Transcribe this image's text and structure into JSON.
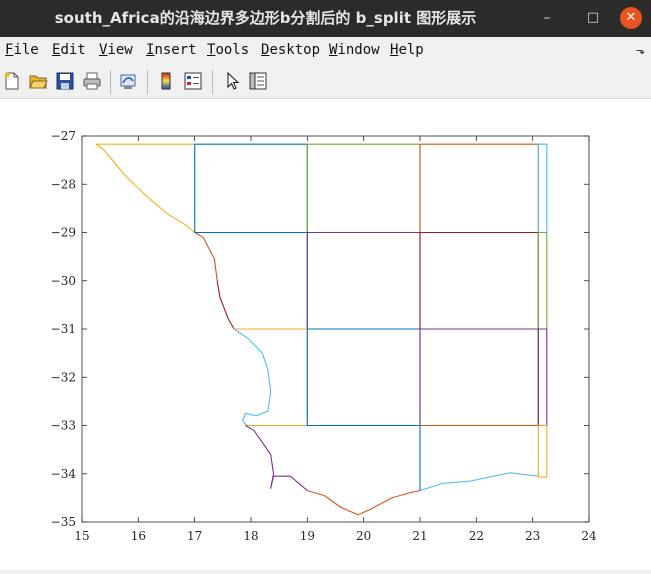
{
  "window": {
    "title": "south_Africa的沿海边界多边形b分割后的 b_split 图形展示",
    "minimize_glyph": "–",
    "maximize_glyph": "□",
    "close_glyph": "✕"
  },
  "menu": [
    {
      "key": "F",
      "rest": "ile"
    },
    {
      "key": "E",
      "rest": "dit"
    },
    {
      "key": "V",
      "rest": "iew"
    },
    {
      "key": "I",
      "rest": "nsert"
    },
    {
      "key": "T",
      "rest": "ools"
    },
    {
      "key": "D",
      "rest": "esktop"
    },
    {
      "key": "W",
      "rest": "indow"
    },
    {
      "key": "H",
      "rest": "elp"
    }
  ],
  "menu_overflow_glyph": "⬎",
  "toolbar": [
    "new-figure-icon",
    "open-file-icon",
    "save-icon",
    "print-icon",
    "link-plot-icon",
    "insert-colorbar-icon",
    "insert-legend-icon",
    "edit-plot-arrow-icon",
    "property-editor-icon"
  ],
  "chart_data": {
    "type": "line",
    "title": "",
    "xlabel": "",
    "ylabel": "",
    "xlim": [
      15,
      24
    ],
    "ylim": [
      -35,
      -27
    ],
    "xticks": [
      15,
      16,
      17,
      18,
      19,
      20,
      21,
      22,
      23,
      24
    ],
    "yticks": [
      -27,
      -28,
      -29,
      -30,
      -31,
      -32,
      -33,
      -34,
      -35
    ],
    "grid": false,
    "legend": "none",
    "series": [
      {
        "color": "#EDB120",
        "points": [
          [
            17,
            -27.17
          ],
          [
            15.25,
            -27.17
          ],
          [
            15.4,
            -27.3
          ],
          [
            15.75,
            -27.8
          ],
          [
            16.1,
            -28.2
          ],
          [
            16.5,
            -28.6
          ],
          [
            16.85,
            -28.85
          ],
          [
            17,
            -29
          ]
        ]
      },
      {
        "color": "#0072BD",
        "points": [
          [
            17,
            -29
          ],
          [
            17,
            -27.17
          ],
          [
            19,
            -27.17
          ],
          [
            19,
            -29
          ],
          [
            17,
            -29
          ]
        ]
      },
      {
        "color": "#77AC30",
        "points": [
          [
            19,
            -27.17
          ],
          [
            21,
            -27.17
          ],
          [
            21,
            -29
          ],
          [
            19,
            -29
          ],
          [
            19,
            -27.17
          ]
        ]
      },
      {
        "color": "#D95319",
        "points": [
          [
            21,
            -27.17
          ],
          [
            23.1,
            -27.17
          ],
          [
            23.1,
            -29
          ],
          [
            21,
            -29
          ],
          [
            21,
            -27.17
          ]
        ]
      },
      {
        "color": "#4DBEEE",
        "points": [
          [
            23.1,
            -27.17
          ],
          [
            23.25,
            -27.17
          ],
          [
            23.25,
            -29
          ],
          [
            23.1,
            -29
          ],
          [
            23.1,
            -27.17
          ]
        ]
      },
      {
        "color": "#D95319",
        "points": [
          [
            17,
            -29
          ],
          [
            17.15,
            -29.1
          ],
          [
            17.35,
            -29.55
          ],
          [
            17.4,
            -30
          ]
        ]
      },
      {
        "color": "#A2142F",
        "points": [
          [
            17.4,
            -30
          ],
          [
            17.45,
            -30.35
          ],
          [
            17.6,
            -30.8
          ],
          [
            17.7,
            -31
          ]
        ]
      },
      {
        "color": "#0072BD",
        "points": [
          [
            17,
            -29
          ],
          [
            19,
            -29
          ],
          [
            19,
            -31
          ],
          [
            17.7,
            -31
          ]
        ]
      },
      {
        "color": "#7E2F8E",
        "points": [
          [
            19,
            -29
          ],
          [
            21,
            -29
          ],
          [
            21,
            -31
          ],
          [
            19,
            -31
          ],
          [
            19,
            -29
          ]
        ]
      },
      {
        "color": "#A2142F",
        "points": [
          [
            21,
            -29
          ],
          [
            23.1,
            -29
          ],
          [
            23.1,
            -31
          ],
          [
            21,
            -31
          ],
          [
            21,
            -29
          ]
        ]
      },
      {
        "color": "#77AC30",
        "points": [
          [
            23.1,
            -29
          ],
          [
            23.25,
            -29
          ],
          [
            23.25,
            -31
          ],
          [
            23.1,
            -31
          ],
          [
            23.1,
            -29
          ]
        ]
      },
      {
        "color": "#4DBEEE",
        "points": [
          [
            17.7,
            -31
          ],
          [
            17.95,
            -31.2
          ],
          [
            18.2,
            -31.5
          ],
          [
            18.3,
            -31.85
          ],
          [
            18.35,
            -32.3
          ],
          [
            18.3,
            -32.7
          ],
          [
            18.1,
            -32.8
          ],
          [
            17.9,
            -32.75
          ],
          [
            17.85,
            -32.9
          ],
          [
            17.92,
            -33
          ]
        ]
      },
      {
        "color": "#EDB120",
        "points": [
          [
            17.7,
            -31
          ],
          [
            19,
            -31
          ],
          [
            19,
            -33
          ],
          [
            17.9,
            -33
          ]
        ]
      },
      {
        "color": "#0072BD",
        "points": [
          [
            19,
            -31
          ],
          [
            21,
            -31
          ],
          [
            21,
            -33
          ],
          [
            19,
            -33
          ],
          [
            19,
            -31
          ]
        ]
      },
      {
        "color": "#7E2F8E",
        "points": [
          [
            21,
            -31
          ],
          [
            23.1,
            -31
          ],
          [
            23.1,
            -33
          ],
          [
            21,
            -33
          ],
          [
            21,
            -31
          ]
        ]
      },
      {
        "color": "#7E2F8E",
        "points": [
          [
            23.1,
            -31
          ],
          [
            23.25,
            -31
          ],
          [
            23.25,
            -33
          ],
          [
            23.1,
            -33
          ],
          [
            23.1,
            -31
          ]
        ]
      },
      {
        "color": "#7E2F8E",
        "points": [
          [
            17.9,
            -33
          ],
          [
            18.05,
            -33.1
          ],
          [
            18.2,
            -33.35
          ],
          [
            18.35,
            -33.6
          ],
          [
            18.4,
            -34
          ],
          [
            18.35,
            -34.3
          ],
          [
            18.4,
            -34.05
          ],
          [
            18.7,
            -34.05
          ],
          [
            19,
            -34.35
          ]
        ]
      },
      {
        "color": "#D95319",
        "points": [
          [
            19,
            -34.35
          ],
          [
            19.3,
            -34.45
          ],
          [
            19.6,
            -34.7
          ],
          [
            19.9,
            -34.85
          ],
          [
            20.1,
            -34.75
          ],
          [
            20.5,
            -34.5
          ],
          [
            20.8,
            -34.4
          ],
          [
            21,
            -34.35
          ]
        ]
      },
      {
        "color": "#0072BD",
        "points": [
          [
            19,
            -33
          ],
          [
            21,
            -33
          ],
          [
            21,
            -34.35
          ]
        ]
      },
      {
        "color": "#4DBEEE",
        "points": [
          [
            21,
            -34.35
          ],
          [
            21.4,
            -34.2
          ],
          [
            21.9,
            -34.15
          ],
          [
            22.3,
            -34.05
          ],
          [
            22.6,
            -33.98
          ],
          [
            23.1,
            -34.05
          ]
        ]
      },
      {
        "color": "#D95319",
        "points": [
          [
            21,
            -33
          ],
          [
            23.1,
            -33
          ]
        ]
      },
      {
        "color": "#EDB120",
        "points": [
          [
            23.1,
            -33
          ],
          [
            23.25,
            -33
          ],
          [
            23.25,
            -34.07
          ],
          [
            23.1,
            -34.07
          ],
          [
            23.1,
            -33
          ]
        ]
      }
    ]
  }
}
